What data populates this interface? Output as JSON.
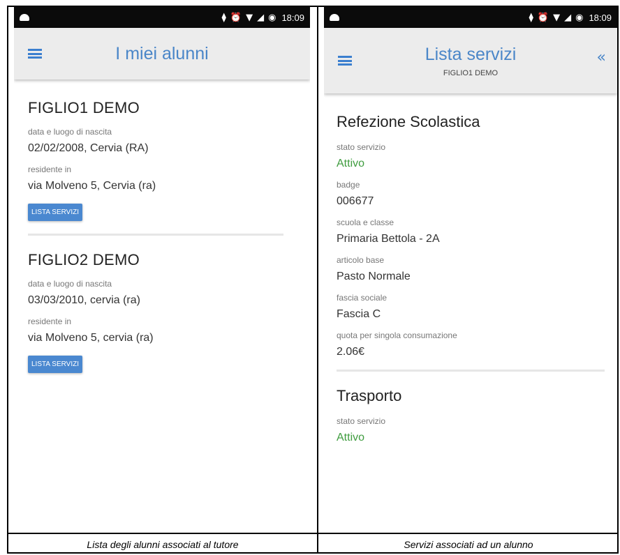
{
  "status_time": "18:09",
  "left": {
    "title": "I miei alunni",
    "students": [
      {
        "name": "FIGLIO1 DEMO",
        "birth_label": "data e luogo di nascita",
        "birth_value": "02/02/2008, Cervia (RA)",
        "residence_label": "residente in",
        "residence_value": "via Molveno 5, Cervia (ra)",
        "button": "LISTA SERVIZI"
      },
      {
        "name": "FIGLIO2 DEMO",
        "birth_label": "data e luogo di nascita",
        "birth_value": "03/03/2010, cervia (ra)",
        "residence_label": "residente in",
        "residence_value": "via Molveno 5, cervia (ra)",
        "button": "LISTA SERVIZI"
      }
    ],
    "caption": "Lista degli alunni associati al tutore"
  },
  "right": {
    "title": "Lista servizi",
    "subtitle": "FIGLIO1 DEMO",
    "services": [
      {
        "name": "Refezione Scolastica",
        "fields": [
          {
            "label": "stato servizio",
            "value": "Attivo",
            "green": true
          },
          {
            "label": "badge",
            "value": "006677"
          },
          {
            "label": "scuola e classe",
            "value": "Primaria Bettola - 2A"
          },
          {
            "label": "articolo base",
            "value": "Pasto Normale"
          },
          {
            "label": "fascia sociale",
            "value": "Fascia C"
          },
          {
            "label": "quota per singola consumazione",
            "value": "2.06€"
          }
        ]
      },
      {
        "name": "Trasporto",
        "fields": [
          {
            "label": "stato servizio",
            "value": "Attivo",
            "green": true
          }
        ]
      }
    ],
    "caption": "Servizi associati ad un alunno"
  },
  "colors": {
    "accent": "#4a86c8",
    "button": "#4a88d0",
    "active": "#3f9c3f",
    "appbar": "#ececec",
    "statusbar": "#0b0b0b"
  }
}
